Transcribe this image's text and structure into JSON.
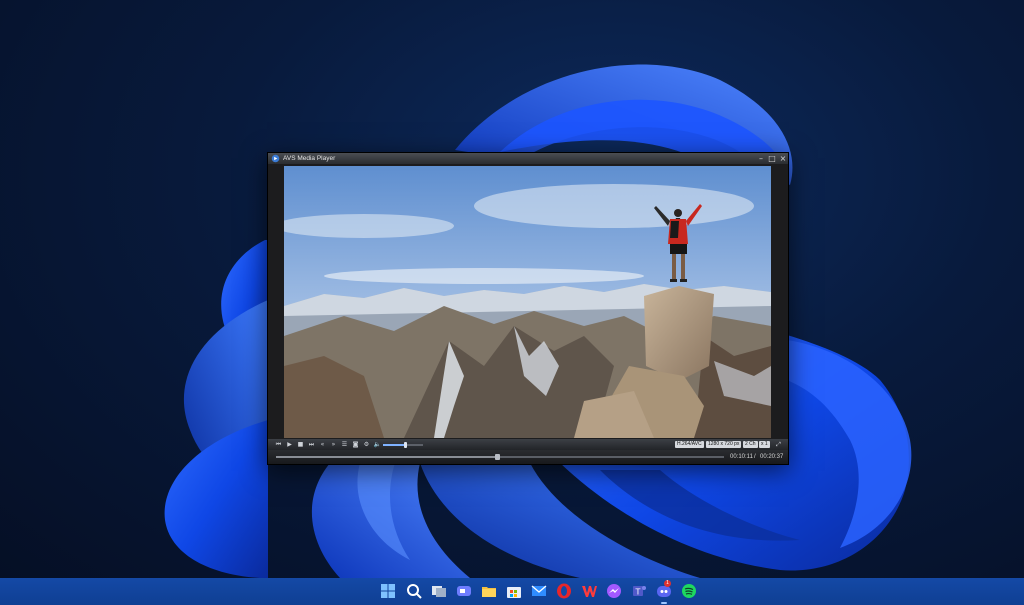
{
  "window": {
    "title": "AVS Media Player"
  },
  "player": {
    "video_scene": "mountain-summit-hiker",
    "badges": {
      "codec": "H.264/AVC",
      "resolution": "1280 x 720 px",
      "channels": "2 Ch",
      "speed": "x 1"
    },
    "time": {
      "current": "00:10:11",
      "separator": "/",
      "total": "00:20:37"
    },
    "progress_fraction": 0.494,
    "volume_fraction": 0.55
  },
  "taskbar": {
    "icons": [
      "windows-start",
      "search",
      "task-view",
      "teams-chat",
      "file-explorer",
      "microsoft-store",
      "mail",
      "opera",
      "wps-office",
      "messenger",
      "teams",
      "discord",
      "spotify"
    ],
    "discord_badge": "1"
  },
  "colors": {
    "accent": "#1f5bff",
    "taskbar": "#1248a6",
    "desktop_bg": "#07152e"
  }
}
